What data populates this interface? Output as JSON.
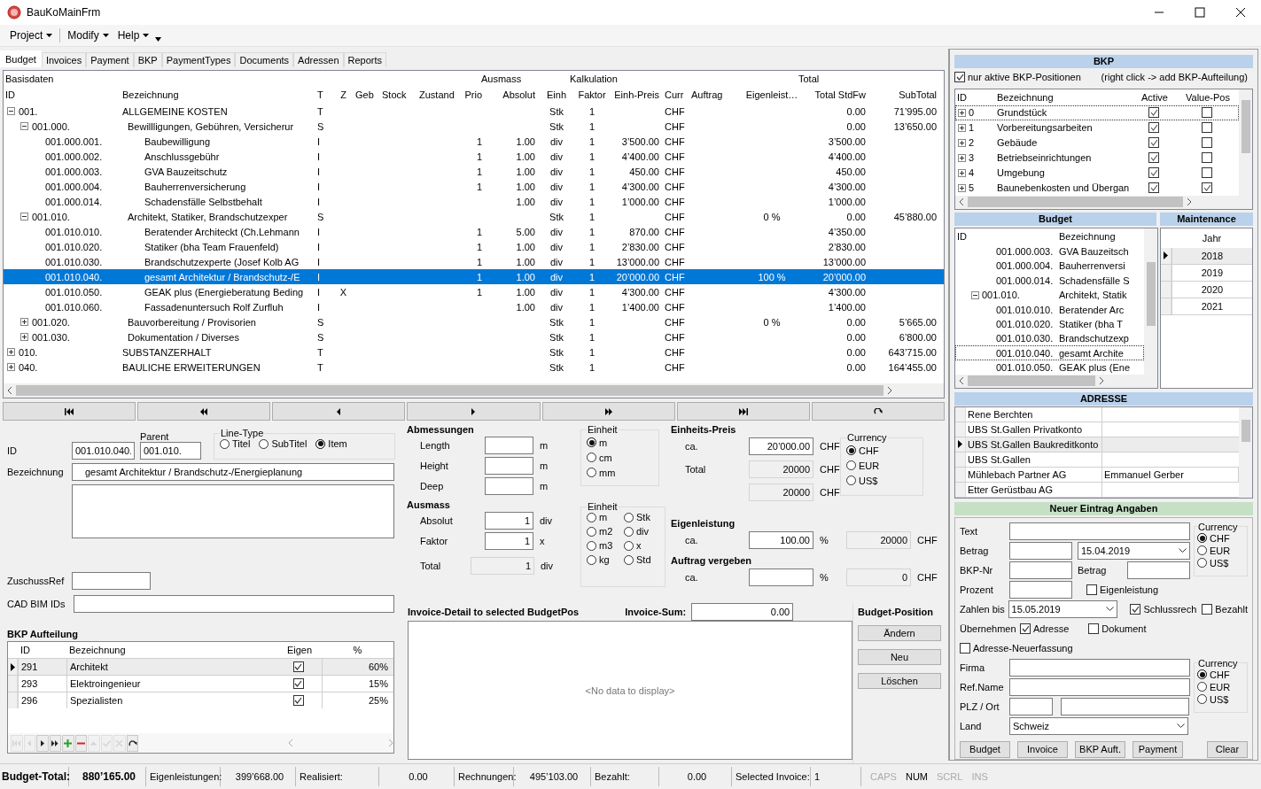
{
  "window": {
    "title": "BauKoMainFrm"
  },
  "menu": [
    {
      "label": "Project"
    },
    {
      "label": "Modify"
    },
    {
      "label": "Help"
    }
  ],
  "tabs": [
    {
      "label": "Budget",
      "selected": true
    },
    {
      "label": "Invoices",
      "selected": false
    },
    {
      "label": "Payment",
      "selected": false
    },
    {
      "label": "BKP",
      "selected": false
    },
    {
      "label": "PaymentTypes",
      "selected": false
    },
    {
      "label": "Documents",
      "selected": false
    },
    {
      "label": "Adressen",
      "selected": false
    },
    {
      "label": "Reports",
      "selected": false
    }
  ],
  "budget_grid": {
    "group_headers": [
      "Basisdaten",
      "Ausmass",
      "Kalkulation",
      "Total"
    ],
    "columns": [
      "ID",
      "Bezeichnung",
      "T",
      "Z",
      "Geb",
      "Stock",
      "Zustand",
      "Prio",
      "Absolut",
      "Einh",
      "Faktor",
      "Einh-Preis",
      "Curr",
      "Auftrag",
      "Eigenleist…",
      "Total StdFw",
      "SubTotal"
    ],
    "rows": [
      {
        "id": "001.",
        "bezeichnung": "ALLGEMEINE KOSTEN",
        "t": "T",
        "einh": "Stk",
        "faktor": "1",
        "curr": "CHF",
        "total_stdfw": "0.00",
        "subtotal": "71’995.00",
        "expanded": true,
        "selected": false,
        "children": [
          {
            "id": "001.000.",
            "bezeichnung": "Bewillligungen, Gebühren, Versicherur",
            "t": "S",
            "einh": "Stk",
            "faktor": "1",
            "curr": "CHF",
            "total_stdfw": "0.00",
            "subtotal": "13’650.00",
            "expanded": true,
            "selected": false,
            "children": [
              {
                "id": "001.000.001.",
                "bezeichnung": "Baubewilligung",
                "t": "I",
                "prio": "1",
                "absolut": "1.00",
                "einh": "div",
                "faktor": "1",
                "einh_preis": "3’500.00",
                "curr": "CHF",
                "total_stdfw": "3’500.00",
                "selected": false
              },
              {
                "id": "001.000.002.",
                "bezeichnung": "Anschlussgebühr",
                "t": "I",
                "prio": "1",
                "absolut": "1.00",
                "einh": "div",
                "faktor": "1",
                "einh_preis": "4’400.00",
                "curr": "CHF",
                "total_stdfw": "4’400.00",
                "selected": false
              },
              {
                "id": "001.000.003.",
                "bezeichnung": "GVA Bauzeitschutz",
                "t": "I",
                "prio": "1",
                "absolut": "1.00",
                "einh": "div",
                "faktor": "1",
                "einh_preis": "450.00",
                "curr": "CHF",
                "total_stdfw": "450.00",
                "selected": false
              },
              {
                "id": "001.000.004.",
                "bezeichnung": "Bauherrenversicherung",
                "t": "I",
                "prio": "1",
                "absolut": "1.00",
                "einh": "div",
                "faktor": "1",
                "einh_preis": "4’300.00",
                "curr": "CHF",
                "total_stdfw": "4’300.00",
                "selected": false
              },
              {
                "id": "001.000.014.",
                "bezeichnung": "Schadensfälle Selbstbehalt",
                "t": "I",
                "absolut": "1.00",
                "einh": "div",
                "faktor": "1",
                "einh_preis": "1’000.00",
                "curr": "CHF",
                "total_stdfw": "1’000.00",
                "selected": false
              }
            ]
          },
          {
            "id": "001.010.",
            "bezeichnung": "Architekt, Statiker, Brandschutzexper",
            "t": "S",
            "einh": "Stk",
            "faktor": "1",
            "curr": "CHF",
            "eigenleistung": "0 %",
            "total_stdfw": "0.00",
            "subtotal": "45’880.00",
            "expanded": true,
            "selected": false,
            "children": [
              {
                "id": "001.010.010.",
                "bezeichnung": "Beratender Architeckt (Ch.Lehmann",
                "t": "I",
                "prio": "1",
                "absolut": "5.00",
                "einh": "div",
                "faktor": "1",
                "einh_preis": "870.00",
                "curr": "CHF",
                "total_stdfw": "4’350.00",
                "selected": false
              },
              {
                "id": "001.010.020.",
                "bezeichnung": "Statiker (bha Team Frauenfeld)",
                "t": "I",
                "prio": "1",
                "absolut": "1.00",
                "einh": "div",
                "faktor": "1",
                "einh_preis": "2’830.00",
                "curr": "CHF",
                "total_stdfw": "2’830.00",
                "selected": false
              },
              {
                "id": "001.010.030.",
                "bezeichnung": "Brandschutzexperte (Josef Kolb AG",
                "t": "I",
                "prio": "1",
                "absolut": "1.00",
                "einh": "div",
                "faktor": "1",
                "einh_preis": "13’000.00",
                "curr": "CHF",
                "total_stdfw": "13’000.00",
                "selected": false
              },
              {
                "id": "001.010.040.",
                "bezeichnung": "gesamt Architektur / Brandschutz-/E",
                "t": "I",
                "prio": "1",
                "absolut": "1.00",
                "einh": "div",
                "faktor": "1",
                "einh_preis": "20’000.00",
                "curr": "CHF",
                "eigenleistung": "100 %",
                "total_stdfw": "20’000.00",
                "selected": true
              },
              {
                "id": "001.010.050.",
                "bezeichnung": "GEAK plus  (Energieberatung Beding",
                "t": "I",
                "z": "X",
                "prio": "1",
                "absolut": "1.00",
                "einh": "div",
                "faktor": "1",
                "einh_preis": "4’300.00",
                "curr": "CHF",
                "total_stdfw": "4’300.00",
                "selected": false
              },
              {
                "id": "001.010.060.",
                "bezeichnung": "Fassadenuntersuch Rolf Zurfluh",
                "t": "I",
                "absolut": "1.00",
                "einh": "div",
                "faktor": "1",
                "einh_preis": "1’400.00",
                "curr": "CHF",
                "total_stdfw": "1’400.00",
                "selected": false
              }
            ]
          },
          {
            "id": "001.020.",
            "bezeichnung": "Bauvorbereitung / Provisorien",
            "t": "S",
            "einh": "Stk",
            "faktor": "1",
            "curr": "CHF",
            "eigenleistung": "0 %",
            "total_stdfw": "0.00",
            "subtotal": "5’665.00",
            "expanded": false,
            "selected": false
          },
          {
            "id": "001.030.",
            "bezeichnung": "Dokumentation / Diverses",
            "t": "S",
            "einh": "Stk",
            "faktor": "1",
            "curr": "CHF",
            "total_stdfw": "0.00",
            "subtotal": "6’800.00",
            "expanded": false,
            "selected": false
          }
        ]
      },
      {
        "id": "010.",
        "bezeichnung": "SUBSTANZERHALT",
        "t": "T",
        "einh": "Stk",
        "faktor": "1",
        "curr": "CHF",
        "total_stdfw": "0.00",
        "subtotal": "643’715.00",
        "expanded": false,
        "selected": false
      },
      {
        "id": "040.",
        "bezeichnung": "BAULICHE ERWEITERUNGEN",
        "t": "T",
        "einh": "Stk",
        "faktor": "1",
        "curr": "CHF",
        "total_stdfw": "0.00",
        "subtotal": "164’455.00",
        "expanded": false,
        "selected": false
      }
    ]
  },
  "position": {
    "id": {
      "label": "ID",
      "value": "001.010.040."
    },
    "parent": {
      "label": "Parent",
      "value": "001.010."
    },
    "line_type": {
      "title": "Line-Type",
      "options": [
        {
          "label": "Titel",
          "selected": false
        },
        {
          "label": "SubTitel",
          "selected": false
        },
        {
          "label": "Item",
          "selected": true
        }
      ]
    },
    "bezeichnung": {
      "label": "Bezeichnung",
      "value": "gesamt Architektur / Brandschutz-/Energieplanung"
    },
    "zuschuss_ref": {
      "label": "ZuschussRef"
    },
    "cad_bim_ids": {
      "label": "CAD BIM IDs"
    }
  },
  "bkp_aufteilung": {
    "title": "BKP Aufteilung",
    "columns": [
      "ID",
      "Bezeichnung",
      "Eigen",
      "%"
    ],
    "rows": [
      {
        "id": "291",
        "bezeichnung": "Architekt",
        "eigen": true,
        "percent": "60%",
        "selected": true
      },
      {
        "id": "293",
        "bezeichnung": "Elektroingenieur",
        "eigen": true,
        "percent": "15%",
        "selected": false
      },
      {
        "id": "296",
        "bezeichnung": "Spezialisten",
        "eigen": true,
        "percent": "25%",
        "selected": false
      }
    ],
    "navigator": [
      {
        "kind": "first",
        "disabled": true
      },
      {
        "kind": "prev",
        "disabled": true
      },
      {
        "kind": "next",
        "disabled": false
      },
      {
        "kind": "last",
        "disabled": false
      },
      {
        "kind": "add",
        "disabled": false
      },
      {
        "kind": "remove",
        "disabled": false
      },
      {
        "kind": "edit",
        "disabled": true
      },
      {
        "kind": "save",
        "disabled": true
      },
      {
        "kind": "cancel",
        "disabled": true
      },
      {
        "kind": "refresh",
        "disabled": false
      }
    ]
  },
  "abmessungen": {
    "title": "Abmessungen",
    "fields": [
      {
        "label": "Length",
        "unit": "m"
      },
      {
        "label": "Height",
        "unit": "m"
      },
      {
        "label": "Deep",
        "unit": "m"
      }
    ]
  },
  "einheit_abmessungen": {
    "title": "Einheit",
    "options": [
      {
        "label": "m",
        "selected": true
      },
      {
        "label": "cm",
        "selected": false
      },
      {
        "label": "mm",
        "selected": false
      }
    ]
  },
  "ausmass": {
    "title": "Ausmass",
    "fields": [
      {
        "label": "Absolut",
        "value": "1",
        "unit": "div",
        "readonly": false
      },
      {
        "label": "Faktor",
        "value": "1",
        "unit": "x",
        "readonly": false
      },
      {
        "label": "Total",
        "value": "1",
        "unit": "div",
        "readonly": true
      }
    ]
  },
  "einheit_ausmass": {
    "title": "Einheit",
    "options": [
      {
        "label": "m",
        "selected": false
      },
      {
        "label": "Stk",
        "selected": false
      },
      {
        "label": "m2",
        "selected": false
      },
      {
        "label": "div",
        "selected": false
      },
      {
        "label": "m3",
        "selected": false
      },
      {
        "label": "x",
        "selected": false
      },
      {
        "label": "kg",
        "selected": false
      },
      {
        "label": "Std",
        "selected": false
      }
    ]
  },
  "einheits_preis": {
    "title": "Einheits-Preis",
    "rows": [
      {
        "label": "ca.",
        "value": "20’000.00",
        "unit": "CHF",
        "readonly": false
      },
      {
        "label": "Total",
        "value": "20000",
        "unit": "CHF",
        "readonly": true
      },
      {
        "value": "20000",
        "unit": "CHF",
        "readonly": true
      }
    ]
  },
  "currency": {
    "title": "Currency",
    "options": [
      {
        "label": "CHF",
        "selected": true
      },
      {
        "label": "EUR",
        "selected": false
      },
      {
        "label": "US$",
        "selected": false
      }
    ]
  },
  "eigenleistung": {
    "title": "Eigenleistung",
    "label": "ca.",
    "value": "100.00",
    "unit": "%",
    "result": "20000",
    "result_unit": "CHF"
  },
  "auftrag_vergeben": {
    "title": "Auftrag vergeben",
    "label": "ca.",
    "unit": "%",
    "result": "0",
    "result_unit": "CHF"
  },
  "invoice_detail": {
    "title": "Invoice-Detail to selected BudgetPos",
    "sum_label": "Invoice-Sum:",
    "sum_value": "0.00",
    "empty_text": "<No data to display>"
  },
  "budget_position": {
    "title": "Budget-Position",
    "buttons": [
      "Ändern",
      "Neu",
      "Löschen"
    ]
  },
  "bkp": {
    "title": "BKP",
    "filter": {
      "label": "nur aktive BKP-Positionen",
      "checked": true
    },
    "hint": "(right click -> add BKP-Aufteilung)",
    "columns": [
      "ID",
      "Bezeichnung",
      "Active",
      "Value-Pos"
    ],
    "rows": [
      {
        "id": "0",
        "bezeichnung": "Grundstück",
        "active": true,
        "value_pos": false,
        "expanded": false,
        "selected": true
      },
      {
        "id": "1",
        "bezeichnung": "Vorbereitungsarbeiten",
        "active": true,
        "value_pos": false,
        "expanded": false,
        "selected": false
      },
      {
        "id": "2",
        "bezeichnung": "Gebäude",
        "active": true,
        "value_pos": false,
        "expanded": false,
        "selected": false
      },
      {
        "id": "3",
        "bezeichnung": "Betriebseinrichtungen",
        "active": true,
        "value_pos": false,
        "expanded": false,
        "selected": false
      },
      {
        "id": "4",
        "bezeichnung": "Umgebung",
        "active": true,
        "value_pos": false,
        "expanded": false,
        "selected": false
      },
      {
        "id": "5",
        "bezeichnung": "Baunebenkosten und Übergan",
        "active": true,
        "value_pos": true,
        "expanded": false,
        "selected": false
      }
    ]
  },
  "budget_tree": {
    "title": "Budget",
    "columns": [
      "ID",
      "Bezeichnung"
    ],
    "rows": [
      {
        "id": "001.000.003.",
        "bezeichnung": "GVA Bauzeitsch",
        "selected": false
      },
      {
        "id": "001.000.004.",
        "bezeichnung": "Bauherrenversi",
        "selected": false
      },
      {
        "id": "001.000.014.",
        "bezeichnung": "Schadensfälle S",
        "selected": false
      },
      {
        "id": "001.010.",
        "bezeichnung": "Architekt, Statik",
        "expanded": true,
        "selected": false,
        "children": [
          {
            "id": "001.010.010.",
            "bezeichnung": "Beratender Arc",
            "selected": false
          },
          {
            "id": "001.010.020.",
            "bezeichnung": "Statiker (bha T",
            "selected": false
          },
          {
            "id": "001.010.030.",
            "bezeichnung": "Brandschutzexp",
            "selected": false
          },
          {
            "id": "001.010.040.",
            "bezeichnung": "gesamt Archite",
            "selected": true
          },
          {
            "id": "001.010.050.",
            "bezeichnung": "GEAK plus  (Ene",
            "selected": false
          }
        ]
      }
    ]
  },
  "maintenance": {
    "title": "Maintenance",
    "column": "Jahr",
    "rows": [
      {
        "label": "2018",
        "selected": true
      },
      {
        "label": "2019",
        "selected": false
      },
      {
        "label": "2020",
        "selected": false
      },
      {
        "label": "2021",
        "selected": false
      }
    ]
  },
  "adresse": {
    "title": "ADRESSE",
    "rows": [
      {
        "name": "Rene Berchten",
        "selected": false
      },
      {
        "name": "UBS St.Gallen Privatkonto",
        "selected": false
      },
      {
        "name": "UBS St.Gallen Baukreditkonto",
        "selected": true
      },
      {
        "name": "UBS St.Gallen",
        "selected": false
      },
      {
        "name": "Mühlebach Partner AG",
        "contact": "Emmanuel Gerber",
        "selected": false
      },
      {
        "name": "Etter Gerüstbau AG",
        "selected": false
      }
    ]
  },
  "neuer_eintrag": {
    "title": "Neuer Eintrag Angaben",
    "text": {
      "label": "Text"
    },
    "betrag": {
      "label": "Betrag"
    },
    "datum": {
      "value": "15.04.2019"
    },
    "bkp_nr": {
      "label": "BKP-Nr"
    },
    "betrag_bkp": {
      "label": "Betrag"
    },
    "prozent": {
      "label": "Prozent"
    },
    "eigenleistung": {
      "label": "Eigenleistung",
      "checked": false
    },
    "zahlen_bis": {
      "label": "Zahlen bis",
      "value": "15.05.2019"
    },
    "schlussrech": {
      "label": "Schlussrech",
      "checked": true
    },
    "bezahlt": {
      "label": "Bezahlt",
      "checked": false
    },
    "uebernehmen": {
      "label": "Übernehmen"
    },
    "adresse": {
      "label": "Adresse",
      "checked": true
    },
    "dokument": {
      "label": "Dokument",
      "checked": false
    },
    "adresse_neuerfassung": {
      "label": "Adresse-Neuerfassung",
      "checked": false
    },
    "firma": {
      "label": "Firma"
    },
    "ref_name": {
      "label": "Ref.Name"
    },
    "plz_ort": {
      "label": "PLZ / Ort"
    },
    "land": {
      "label": "Land",
      "value": "Schweiz"
    },
    "currency_betrag": {
      "title": "Currency",
      "options": [
        {
          "label": "CHF",
          "selected": true
        },
        {
          "label": "EUR",
          "selected": false
        },
        {
          "label": "US$",
          "selected": false
        }
      ]
    },
    "currency_adresse": {
      "title": "Currency",
      "options": [
        {
          "label": "CHF",
          "selected": true
        },
        {
          "label": "EUR",
          "selected": false
        },
        {
          "label": "US$",
          "selected": false
        }
      ]
    },
    "buttons": [
      "Budget",
      "Invoice",
      "BKP Auft.",
      "Payment",
      "Clear"
    ]
  },
  "status_bar": {
    "fields": [
      {
        "label": "Budget-Total:",
        "value": "880’165.00",
        "bold": true
      },
      {
        "label": "Eigenleistungen:",
        "value": "399’668.00",
        "bold": false
      },
      {
        "label": "Realisiert:",
        "value": "0.00",
        "bold": false
      },
      {
        "label": "Rechnungen:",
        "value": "495’103.00",
        "bold": false
      },
      {
        "label": "Bezahlt:",
        "value": "0.00",
        "bold": false
      },
      {
        "label": "Selected Invoice:",
        "value": "1",
        "bold": false
      }
    ],
    "keys": [
      {
        "label": "CAPS",
        "on": false
      },
      {
        "label": "NUM",
        "on": true
      },
      {
        "label": "SCRL",
        "on": false
      },
      {
        "label": "INS",
        "on": false
      }
    ]
  }
}
